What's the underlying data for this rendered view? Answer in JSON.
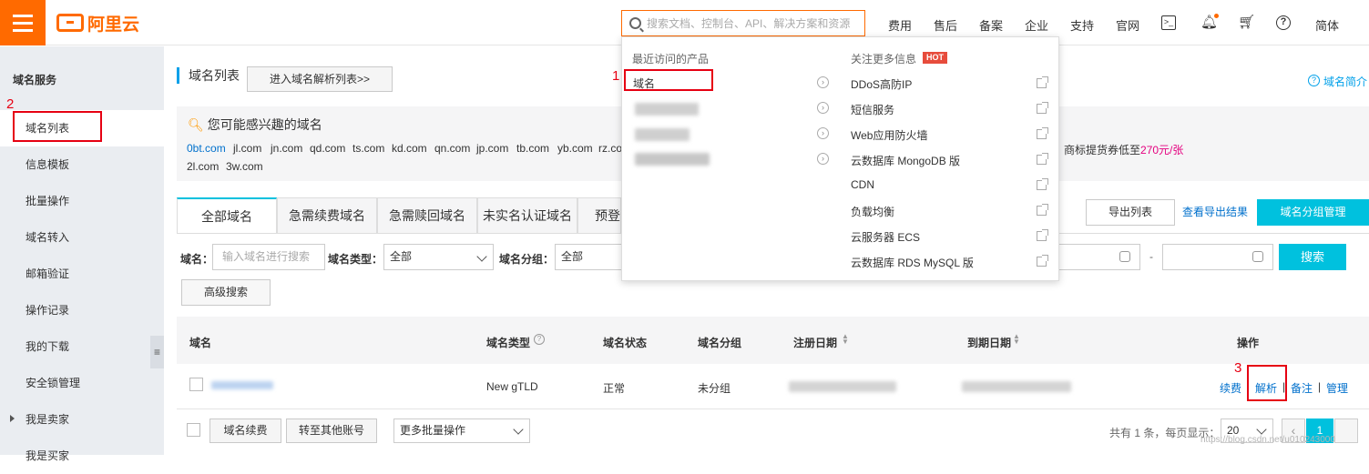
{
  "brand": {
    "logo_text": "阿里云"
  },
  "search": {
    "placeholder": "搜索文档、控制台、API、解决方案和资源"
  },
  "topnav": [
    "费用",
    "售后",
    "备案",
    "企业",
    "支持",
    "官网",
    "简体"
  ],
  "topicons": [
    "terminal-icon",
    "bell-icon",
    "cart-icon",
    "help-icon"
  ],
  "sidebar": {
    "title": "域名服务",
    "items": [
      {
        "label": "域名列表"
      },
      {
        "label": "信息模板"
      },
      {
        "label": "批量操作"
      },
      {
        "label": "域名转入"
      },
      {
        "label": "邮箱验证"
      },
      {
        "label": "操作记录"
      },
      {
        "label": "我的下载"
      },
      {
        "label": "安全锁管理"
      },
      {
        "label": "我是卖家"
      },
      {
        "label": "我是买家"
      }
    ]
  },
  "page": {
    "title": "域名列表",
    "parse_list_button": "进入域名解析列表>>",
    "intro_link": "域名简介"
  },
  "guess": {
    "title": "您可能感兴趣的域名",
    "row1": [
      "0bt.com",
      "jl.com",
      "jn.com",
      "qd.com",
      "ts.com",
      "kd.com",
      "qn.com",
      "jp.com",
      "tb.com",
      "yb.com",
      "rz.co"
    ],
    "row2": [
      "2l.com",
      "3w.com"
    ],
    "promo_prefix": "商标提货券低至",
    "promo_price": "270元/张"
  },
  "tabs": [
    "全部域名",
    "急需续费域名",
    "急需赎回域名",
    "未实名认证域名",
    "预登"
  ],
  "actions": {
    "export": "导出列表",
    "view_export": "查看导出结果",
    "group_manage": "域名分组管理"
  },
  "filters": {
    "domain_label": "域名：",
    "domain_placeholder": "输入域名进行搜索",
    "type_label": "域名类型：",
    "type_value": "全部",
    "group_label": "域名分组：",
    "group_value": "全部",
    "date_sep": "-",
    "search_button": "搜索",
    "advanced_button": "高级搜索"
  },
  "table": {
    "headers": [
      "域名",
      "域名类型",
      "域名状态",
      "域名分组",
      "注册日期",
      "到期日期",
      "操作"
    ],
    "row": {
      "type": "New gTLD",
      "status": "正常",
      "group": "未分组",
      "ops": [
        "续费",
        "解析",
        "备注",
        "管理"
      ]
    }
  },
  "footer": {
    "renew_button": "域名续费",
    "transfer_button": "转至其他账号",
    "batch_select": "更多批量操作",
    "total": "共有 1 条，每页显示：",
    "page_size": "20",
    "prev": "‹",
    "page": "1"
  },
  "dropdown": {
    "recent_title": "最近访问的产品",
    "recent_items": [
      "域名"
    ],
    "more_title": "关注更多信息",
    "hot_badge": "HOT",
    "more_items": [
      "DDoS高防IP",
      "短信服务",
      "Web应用防火墙",
      "云数据库 MongoDB 版",
      "CDN",
      "负载均衡",
      "云服务器 ECS",
      "云数据库 RDS MySQL 版"
    ]
  },
  "annotations": [
    "1",
    "2",
    "3"
  ],
  "watermark": "https://blog.csdn.net/u010243000",
  "colors": {
    "brand": "#ff6a00",
    "accent": "#00c1de",
    "link": "#0070cc",
    "annotation": "#e60012"
  }
}
